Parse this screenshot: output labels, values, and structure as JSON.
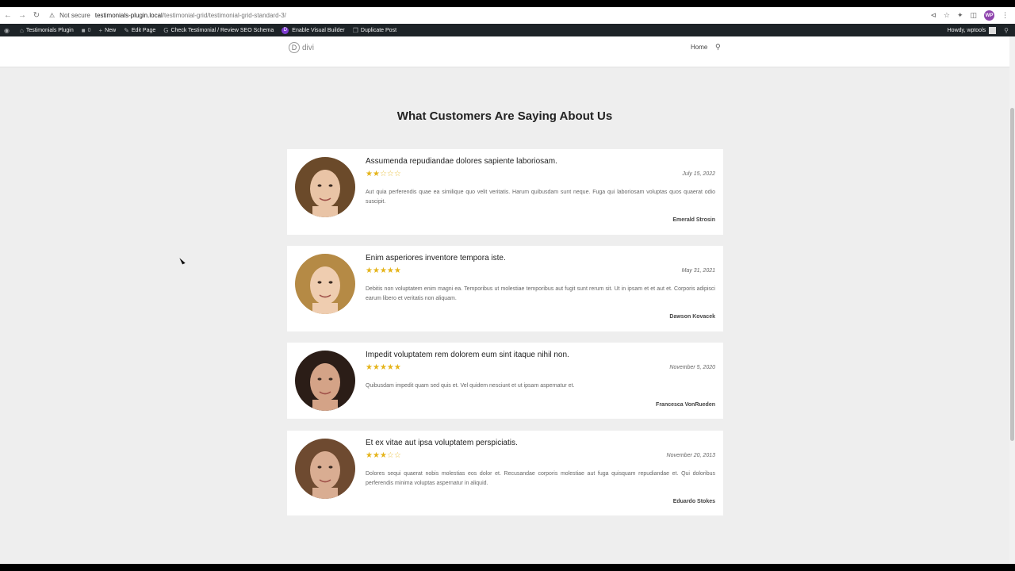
{
  "browser": {
    "security_label": "Not secure",
    "url_host": "testimonials-plugin.local",
    "url_path": "/testimonial-grid/testimonial-grid-standard-3/"
  },
  "adminbar": {
    "site_name": "Testimonials Plugin",
    "comments_count": "0",
    "new_label": "New",
    "edit_page_label": "Edit Page",
    "check_label": "Check Testimonial / Review SEO Schema",
    "visual_builder_label": "Enable Visual Builder",
    "duplicate_label": "Duplicate Post",
    "howdy_label": "Howdy, wptools"
  },
  "site": {
    "logo_text": "divi",
    "menu_home": "Home"
  },
  "heading": "What Customers Are Saying About Us",
  "testimonials": [
    {
      "title": "Assumenda repudiandae dolores sapiente laboriosam.",
      "rating": 2,
      "date": "July 15, 2022",
      "body": "Aut quia perferendis quae ea similique quo velit veritatis. Harum quibusdam sunt neque. Fuga qui laboriosam voluptas quos quaerat odio suscipit.",
      "author": "Emerald Strosin"
    },
    {
      "title": "Enim asperiores inventore tempora iste.",
      "rating": 5,
      "date": "May 31, 2021",
      "body": "Debitis non voluptatem enim magni ea. Temporibus ut molestiae temporibus aut fugit sunt rerum sit. Ut in ipsam et et aut et. Corporis adipisci earum libero et veritatis non aliquam.",
      "author": "Dawson Kovacek"
    },
    {
      "title": "Impedit voluptatem rem dolorem eum sint itaque nihil non.",
      "rating": 5,
      "date": "November 5, 2020",
      "body": "Quibusdam impedit quam sed quis et. Vel quidem nesciunt et ut ipsam aspernatur et.",
      "author": "Francesca VonRueden"
    },
    {
      "title": "Et ex vitae aut ipsa voluptatem perspiciatis.",
      "rating": 3,
      "date": "November 20, 2013",
      "body": "Dolores sequi quaerat nobis molestias eos dolor et. Recusandae corporis molestiae aut fuga quisquam repudiandae et. Qui doloribus perferendis minima voluptas aspernatur in aliquid.",
      "author": "Eduardo Stokes"
    }
  ],
  "colors": {
    "star": "#e5b41a",
    "adminbar": "#1d2327",
    "page_bg": "#eeeeee"
  }
}
